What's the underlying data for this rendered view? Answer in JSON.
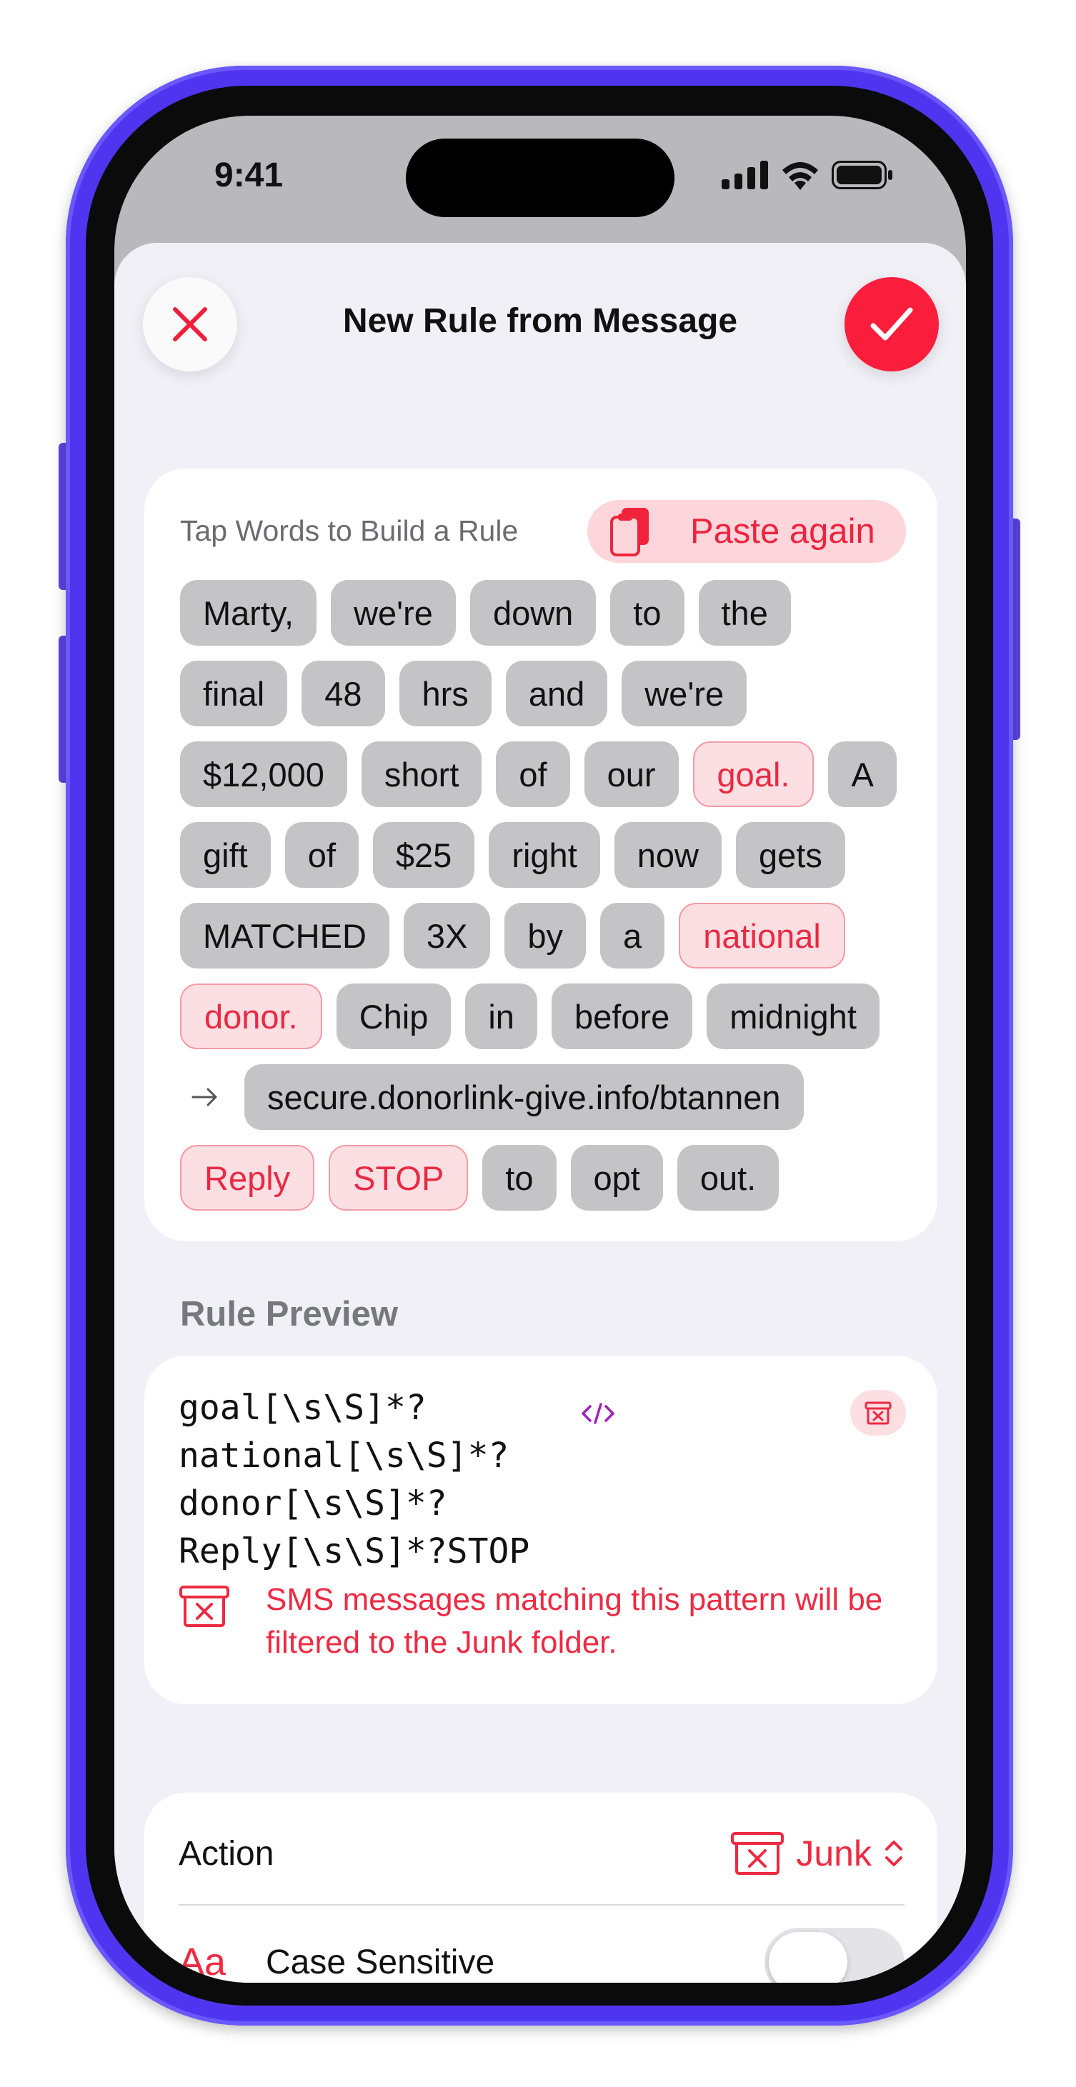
{
  "status": {
    "time": "9:41"
  },
  "nav": {
    "title": "New Rule from Message"
  },
  "words_card": {
    "heading": "Tap Words to Build a Rule",
    "paste_label": "Paste again",
    "rows": [
      [
        {
          "t": "Marty,",
          "s": false
        },
        {
          "t": "we're",
          "s": false
        },
        {
          "t": "down",
          "s": false
        },
        {
          "t": "to",
          "s": false
        },
        {
          "t": "the",
          "s": false
        }
      ],
      [
        {
          "t": "final",
          "s": false
        },
        {
          "t": "48",
          "s": false
        },
        {
          "t": "hrs",
          "s": false
        },
        {
          "t": "and",
          "s": false
        },
        {
          "t": "we're",
          "s": false
        }
      ],
      [
        {
          "t": "$12,000",
          "s": false
        },
        {
          "t": "short",
          "s": false
        },
        {
          "t": "of",
          "s": false
        },
        {
          "t": "our",
          "s": false
        },
        {
          "t": "goal.",
          "s": true
        },
        {
          "t": "A",
          "s": false
        }
      ],
      [
        {
          "t": "gift",
          "s": false
        },
        {
          "t": "of",
          "s": false
        },
        {
          "t": "$25",
          "s": false
        },
        {
          "t": "right",
          "s": false
        },
        {
          "t": "now",
          "s": false
        },
        {
          "t": "gets",
          "s": false
        }
      ],
      [
        {
          "t": "MATCHED",
          "s": false
        },
        {
          "t": "3X",
          "s": false
        },
        {
          "t": "by",
          "s": false
        },
        {
          "t": "a",
          "s": false
        },
        {
          "t": "national",
          "s": true
        }
      ],
      [
        {
          "t": "donor.",
          "s": true
        },
        {
          "t": "Chip",
          "s": false
        },
        {
          "t": "in",
          "s": false
        },
        {
          "t": "before",
          "s": false
        },
        {
          "t": "midnight",
          "s": false
        }
      ],
      [
        {
          "arrow": true
        },
        {
          "t": "secure.donorlink-give.info/btannen",
          "s": false
        }
      ],
      [
        {
          "t": "Reply",
          "s": true
        },
        {
          "t": "STOP",
          "s": true
        },
        {
          "t": "to",
          "s": false
        },
        {
          "t": "opt",
          "s": false
        },
        {
          "t": "out.",
          "s": false
        }
      ]
    ]
  },
  "preview": {
    "label": "Rule Preview",
    "regex": "goal[\\s\\S]*?\nnational[\\s\\S]*?\ndonor[\\s\\S]*?\nReply[\\s\\S]*?STOP",
    "note": "SMS messages matching this pattern will be filtered to the Junk folder."
  },
  "options": {
    "action_label": "Action",
    "action_value": "Junk",
    "case_label": "Case Sensitive",
    "case_icon_text": "Aa",
    "case_sensitive": false
  },
  "colors": {
    "accent": "#fb1d3c",
    "frame": "#4f35f0"
  }
}
